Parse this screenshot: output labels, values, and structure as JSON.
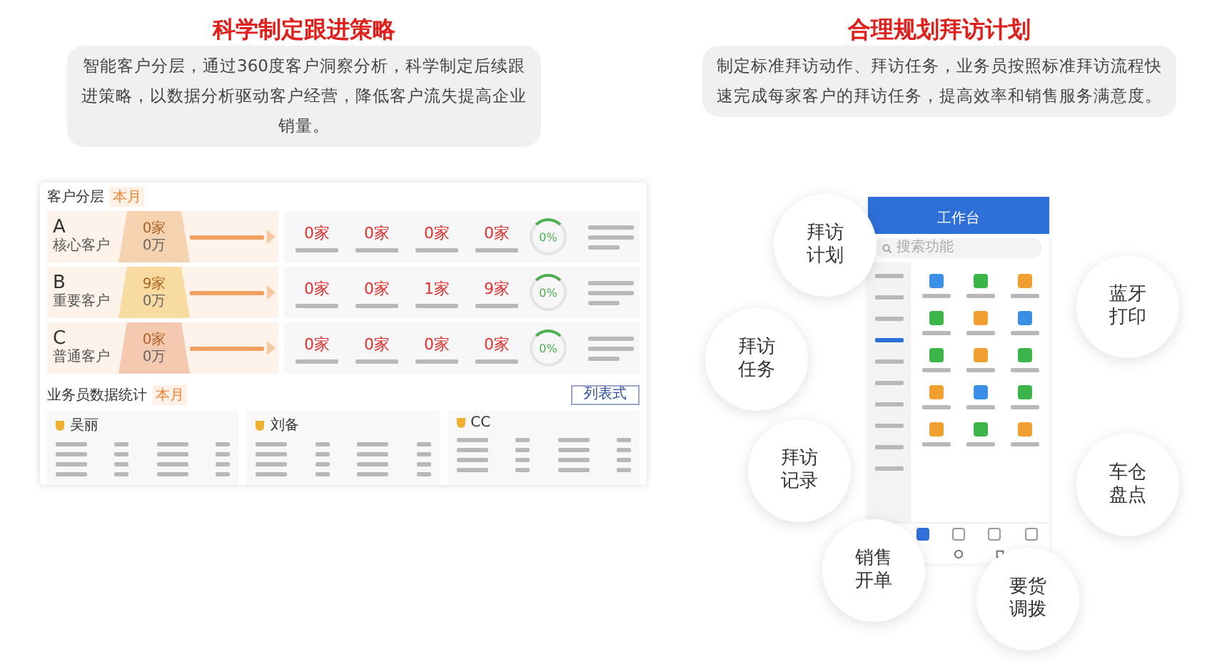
{
  "features": [
    {
      "title": "科学制定跟进策略",
      "description": "智能客户分层，通过360度客户洞察分析，科学制定后续跟进策略，以数据分析驱动客户经营，降低客户流失提高企业销量。"
    },
    {
      "title": "合理规划拜访计划",
      "description": "制定标准拜访动作、拜访任务，业务员按照标准拜访流程快速完成每家客户的拜访任务，提高效率和销售服务满意度。"
    }
  ],
  "dashboard": {
    "title": "客户分层",
    "badge": "本月",
    "tiers": [
      {
        "letter": "A",
        "name": "核心客户",
        "count": "0家",
        "amount": "0万",
        "metrics": [
          "0家",
          "0家",
          "0家",
          "0家"
        ],
        "rate": "0%"
      },
      {
        "letter": "B",
        "name": "重要客户",
        "count": "9家",
        "amount": "0万",
        "metrics": [
          "0家",
          "0家",
          "1家",
          "9家"
        ],
        "rate": "0%"
      },
      {
        "letter": "C",
        "name": "普通客户",
        "count": "0家",
        "amount": "0万",
        "metrics": [
          "0家",
          "0家",
          "0家",
          "0家"
        ],
        "rate": "0%"
      }
    ],
    "staff": {
      "title": "业务员数据统计",
      "badge": "本月",
      "button": "列表式",
      "people": [
        {
          "name": "吴丽"
        },
        {
          "name": "刘备"
        },
        {
          "name": "CC"
        }
      ]
    }
  },
  "phone": {
    "title": "工作台",
    "search_placeholder": "搜索功能"
  },
  "bubbles": [
    "拜访计划",
    "拜访任务",
    "拜访记录",
    "销售开单",
    "要货调拨",
    "蓝牙打印",
    "车仓盘点"
  ]
}
